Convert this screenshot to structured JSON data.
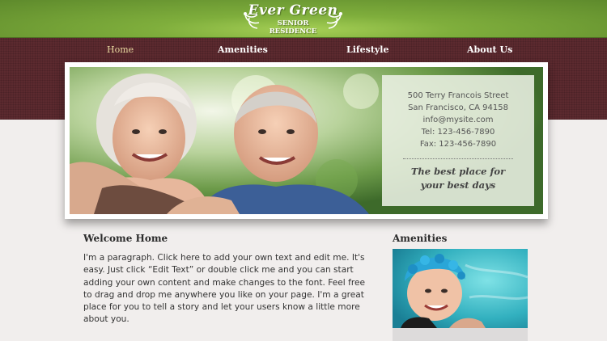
{
  "logo": {
    "title": "Ever Green",
    "subtitle_line1": "SENIOR",
    "subtitle_line2": "RESIDENCE"
  },
  "nav": {
    "items": [
      {
        "label": "Home",
        "active": true
      },
      {
        "label": "Amenities",
        "active": false
      },
      {
        "label": "Lifestyle",
        "active": false
      },
      {
        "label": "About Us",
        "active": false
      }
    ]
  },
  "hero": {
    "address": "500 Terry Francois Street",
    "city": "San Francisco, CA  94158",
    "email": "info@mysite.com",
    "tel": "Tel: 123-456-7890",
    "fax": "Fax: 123-456-7890",
    "tagline_line1": "The best place for",
    "tagline_line2": "your best days"
  },
  "welcome": {
    "title": "Welcome Home",
    "body": "I'm a paragraph. Click here to add your own text and edit me. It's easy. Just click “Edit Text” or double click me and you can start adding your own content and make changes to the font. Feel free to drag and drop me anywhere you like on your page. I'm a great place for you to tell a story and let your users know a little more about you."
  },
  "amenities": {
    "title": "Amenities"
  },
  "colors": {
    "header_green": "#7fae3c",
    "nav_maroon": "#5c2a2f",
    "active_nav": "#e8d9a0",
    "page_bg": "#f1eeed"
  }
}
